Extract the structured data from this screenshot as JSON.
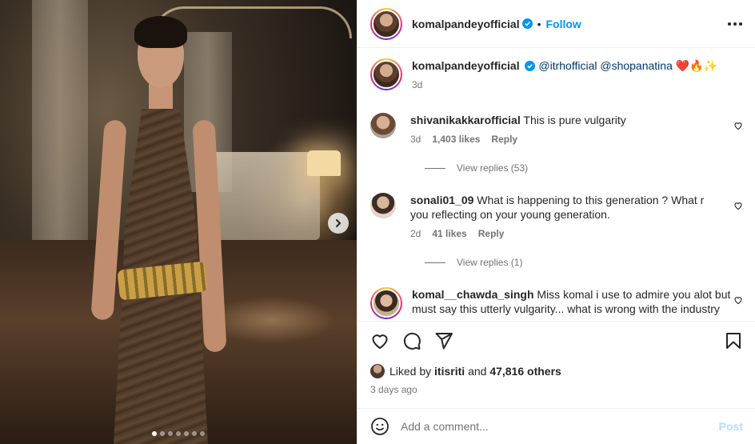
{
  "post": {
    "username": "komalpandeyofficial",
    "follow_label": "Follow",
    "dot": "•",
    "carousel_dots": 7
  },
  "caption": {
    "username": "komalpandeyofficial",
    "mention1": "@itrhofficial",
    "mention2": "@shopanatina",
    "emojis": "❤️🔥✨",
    "time": "3d"
  },
  "comments": [
    {
      "username": "shivanikakkarofficial",
      "text": "This is pure vulgarity",
      "time": "3d",
      "likes": "1,403 likes",
      "reply": "Reply",
      "view_replies": "View replies (53)"
    },
    {
      "username": "sonali01_09",
      "text": "What is happening to this generation ? What r you reflecting on your young generation.",
      "time": "2d",
      "likes": "41 likes",
      "reply": "Reply",
      "view_replies": "View replies (1)"
    },
    {
      "username": "komal__chawda_singh",
      "text": "Miss komal i use to admire you alot but must say this utterly vulgarity... what is wrong with the industry"
    }
  ],
  "likes": {
    "prefix": "Liked by",
    "liker": "itisriti",
    "middle": "and",
    "count": "47,816 others"
  },
  "date": "3 days ago",
  "add_comment": {
    "placeholder": "Add a comment...",
    "post_label": "Post"
  },
  "colors": {
    "link_blue": "#0095f6",
    "mention": "#00376b",
    "post_disabled": "#b2dffc",
    "muted": "#737373"
  },
  "icons": [
    "heart-icon",
    "comment-icon",
    "share-icon",
    "bookmark-icon",
    "emoji-icon",
    "more-icon",
    "verified-icon",
    "chevron-right-icon"
  ]
}
